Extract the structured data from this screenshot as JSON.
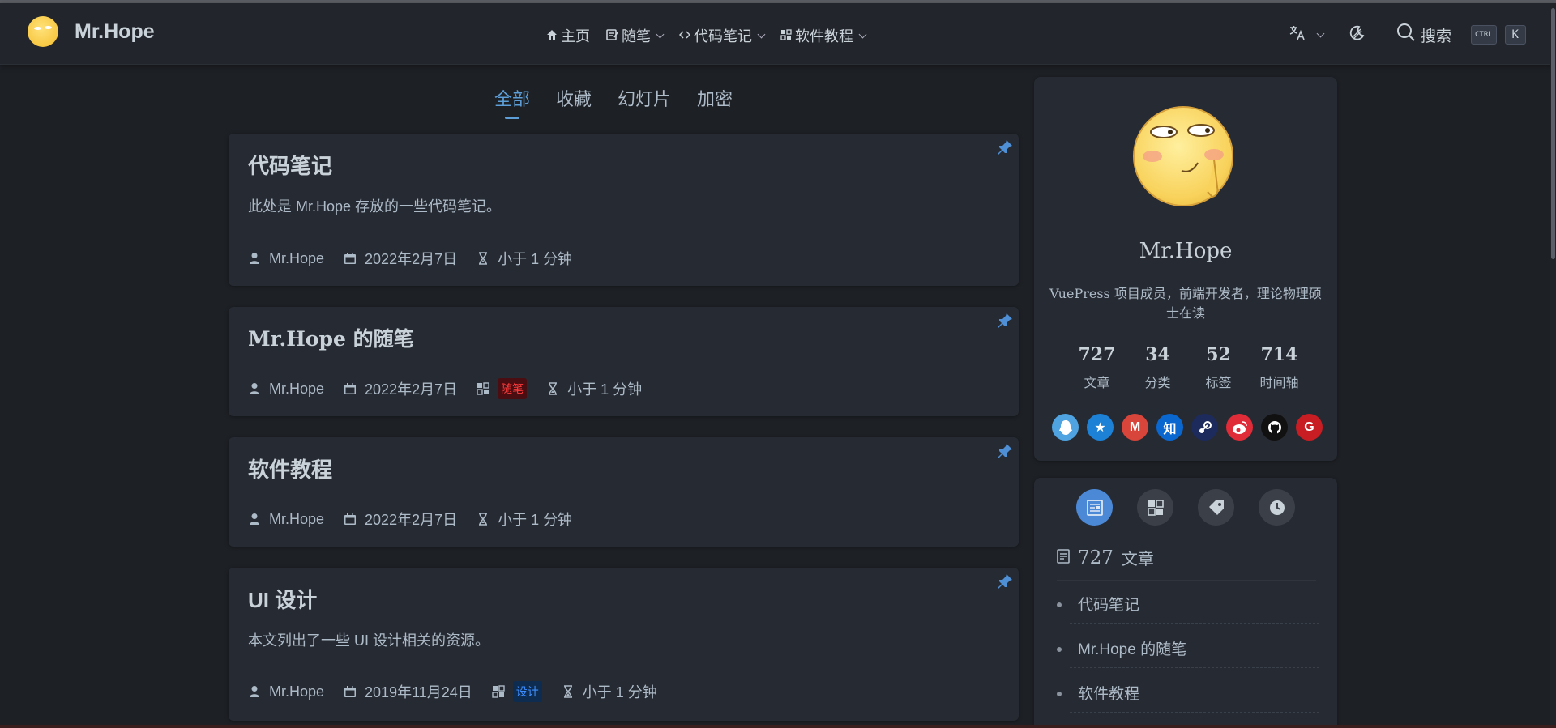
{
  "brand": {
    "name": "Mr.Hope"
  },
  "nav": {
    "items": [
      {
        "label": "主页",
        "has_dropdown": false
      },
      {
        "label": "随笔",
        "has_dropdown": true
      },
      {
        "label": "代码笔记",
        "has_dropdown": true
      },
      {
        "label": "软件教程",
        "has_dropdown": true
      }
    ],
    "search_label": "搜索",
    "kbd_ctrl": "CTRL",
    "kbd_k": "K"
  },
  "tabs": [
    "全部",
    "收藏",
    "幻灯片",
    "加密"
  ],
  "active_tab": "全部",
  "articles": [
    {
      "title": "代码笔记",
      "desc": "此处是 Mr.Hope 存放的一些代码笔记。",
      "author": "Mr.Hope",
      "date": "2022年2月7日",
      "category": "",
      "reading": "小于 1 分钟",
      "pinned": true
    },
    {
      "title": "Mr.Hope 的随笔",
      "desc": "",
      "author": "Mr.Hope",
      "date": "2022年2月7日",
      "category": "随笔",
      "reading": "小于 1 分钟",
      "pinned": true
    },
    {
      "title": "软件教程",
      "desc": "",
      "author": "Mr.Hope",
      "date": "2022年2月7日",
      "category": "",
      "reading": "小于 1 分钟",
      "pinned": true
    },
    {
      "title": "UI 设计",
      "desc": "本文列出了一些 UI 设计相关的资源。",
      "author": "Mr.Hope",
      "date": "2019年11月24日",
      "category": "设计",
      "reading": "小于 1 分钟",
      "pinned": true
    }
  ],
  "blogger": {
    "name": "Mr.Hope",
    "desc": "VuePress 项目成员，前端开发者，理论物理硕士在读",
    "stats": [
      {
        "num": "727",
        "label": "文章"
      },
      {
        "num": "34",
        "label": "分类"
      },
      {
        "num": "52",
        "label": "标签"
      },
      {
        "num": "714",
        "label": "时间轴"
      }
    ],
    "socials": [
      {
        "icon": "qq-icon",
        "color": "#4fa3e0",
        "glyph": ""
      },
      {
        "icon": "qzone-icon",
        "color": "#1d82d6",
        "glyph": "★"
      },
      {
        "icon": "gmail-icon",
        "color": "#d8453b",
        "glyph": "M"
      },
      {
        "icon": "zhihu-icon",
        "color": "#0a67d0",
        "glyph": "知"
      },
      {
        "icon": "steam-icon",
        "color": "#1c2a5c",
        "glyph": ""
      },
      {
        "icon": "weibo-icon",
        "color": "#e02b38",
        "glyph": ""
      },
      {
        "icon": "github-icon",
        "color": "#111111",
        "glyph": ""
      },
      {
        "icon": "gitee-icon",
        "color": "#c71d23",
        "glyph": "G"
      }
    ]
  },
  "info": {
    "count": "727",
    "label": "文章",
    "items": [
      "代码笔记",
      "Mr.Hope 的随笔",
      "软件教程"
    ]
  },
  "colors": {
    "accent": "#5d9ed8",
    "bg": "#1d2025",
    "card": "#262a32"
  }
}
